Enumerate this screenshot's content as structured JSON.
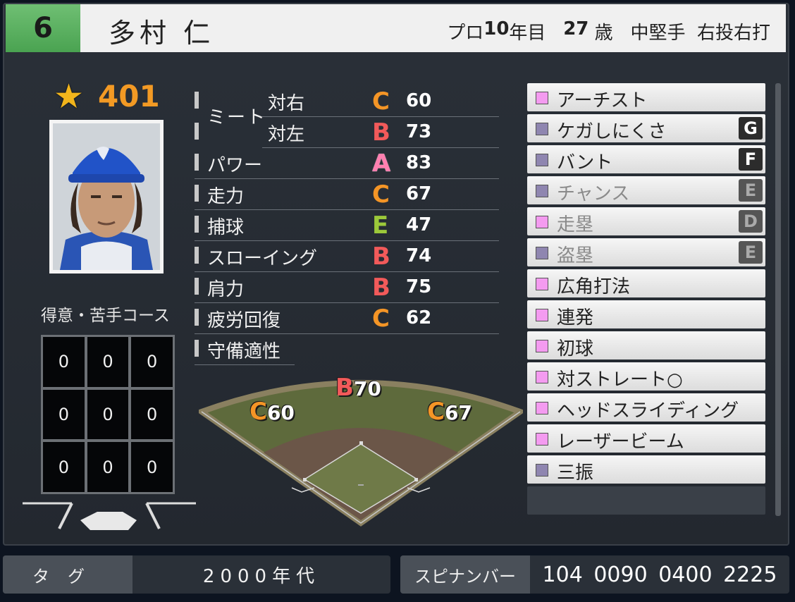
{
  "header": {
    "number": "6",
    "name": "多村 仁",
    "info": [
      {
        "text": "プロ",
        "bold": false
      },
      {
        "text": "10",
        "bold": true
      },
      {
        "text": "年目   ",
        "bold": false
      },
      {
        "text": "27",
        "bold": true
      },
      {
        "text": " 歳   中堅手  右投右打",
        "bold": false
      }
    ]
  },
  "rating": {
    "value": "401",
    "icon": "star-icon"
  },
  "zone": {
    "title": "得意・苦手コース",
    "cells": [
      "0",
      "0",
      "0",
      "0",
      "0",
      "0",
      "0",
      "0",
      "0"
    ]
  },
  "stats": {
    "meet_label": "ミート",
    "rows": [
      {
        "label": "対右",
        "grade": "C",
        "value": "60"
      },
      {
        "label": "対左",
        "grade": "B",
        "value": "73"
      },
      {
        "label": "パワー",
        "grade": "A",
        "value": "83"
      },
      {
        "label": "走力",
        "grade": "C",
        "value": "67"
      },
      {
        "label": "捕球",
        "grade": "E",
        "value": "47"
      },
      {
        "label": "スローイング",
        "grade": "B",
        "value": "74"
      },
      {
        "label": "肩力",
        "grade": "B",
        "value": "75"
      },
      {
        "label": "疲労回復",
        "grade": "C",
        "value": "62"
      },
      {
        "label": "守備適性",
        "grade": "",
        "value": ""
      }
    ]
  },
  "field": {
    "left": {
      "grade": "C",
      "value": "60"
    },
    "center": {
      "grade": "B",
      "value": "70"
    },
    "right": {
      "grade": "C",
      "value": "67"
    }
  },
  "abilities": [
    {
      "name": "アーチスト",
      "color": "pink",
      "rank": "",
      "dim": false
    },
    {
      "name": "ケガしにくさ",
      "color": "purple",
      "rank": "G",
      "dim": false
    },
    {
      "name": "バント",
      "color": "purple",
      "rank": "F",
      "dim": false
    },
    {
      "name": "チャンス",
      "color": "purple",
      "rank": "E",
      "dim": true
    },
    {
      "name": "走塁",
      "color": "pink",
      "rank": "D",
      "dim": true
    },
    {
      "name": "盗塁",
      "color": "purple",
      "rank": "E",
      "dim": true
    },
    {
      "name": "広角打法",
      "color": "pink",
      "rank": "",
      "dim": false
    },
    {
      "name": "連発",
      "color": "pink",
      "rank": "",
      "dim": false
    },
    {
      "name": "初球",
      "color": "pink",
      "rank": "",
      "dim": false
    },
    {
      "name": "対ストレート○",
      "color": "pink",
      "rank": "",
      "dim": false
    },
    {
      "name": "ヘッドスライディング",
      "color": "pink",
      "rank": "",
      "dim": false
    },
    {
      "name": "レーザービーム",
      "color": "pink",
      "rank": "",
      "dim": false
    },
    {
      "name": "三振",
      "color": "purple",
      "rank": "",
      "dim": false
    }
  ],
  "footer": {
    "tag_label": "タグ",
    "tag_value": "2000年代",
    "spin_label": "スピナンバー",
    "spin_value": "104 0090 0400 2225"
  }
}
